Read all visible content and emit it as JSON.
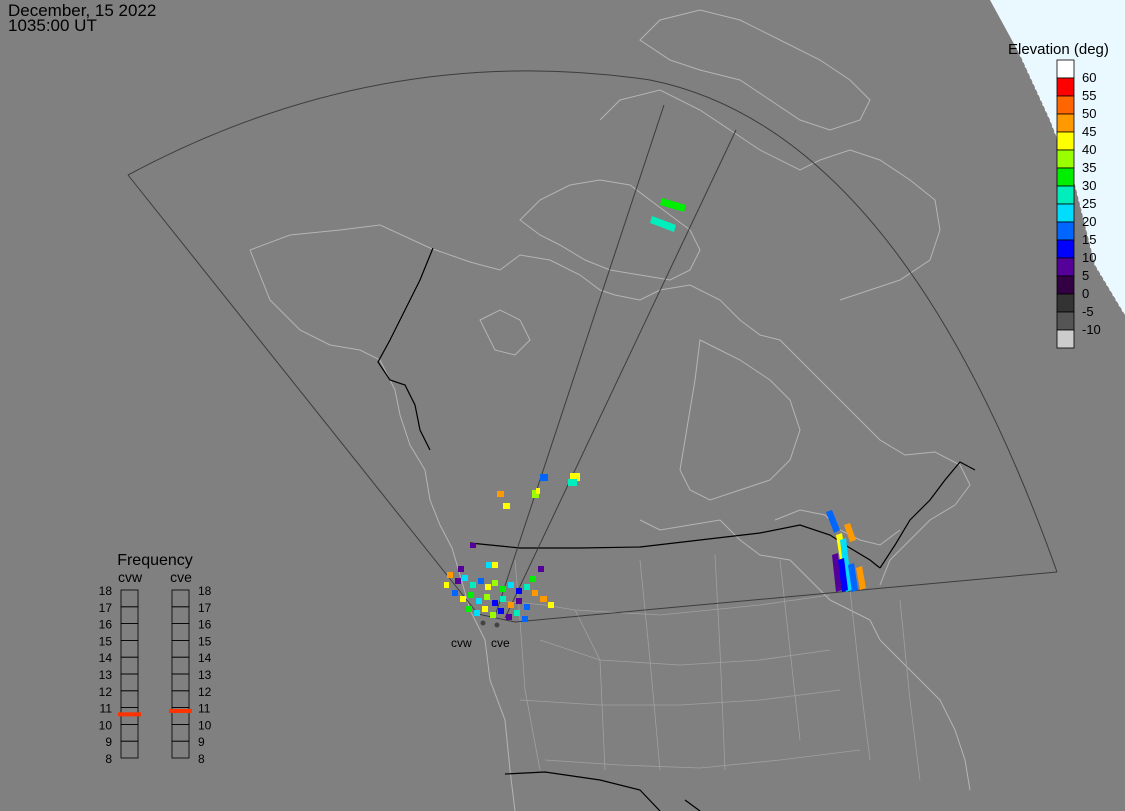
{
  "header": {
    "date": "December, 15 2022",
    "time": "1035:00 UT"
  },
  "colors": {
    "background": "#808080",
    "land_lines": "#b0b0b0",
    "borders": "#000000",
    "fov_lines": "#4a4a4a",
    "daylight_region": "#e8f8ff",
    "frequency_marker": "#ff3300"
  },
  "elevation_legend": {
    "title": "Elevation (deg)",
    "levels": [
      {
        "label": "60",
        "color": "#ffffff"
      },
      {
        "label": "55",
        "color": "#ff0000"
      },
      {
        "label": "50",
        "color": "#ff6600"
      },
      {
        "label": "45",
        "color": "#ff9900"
      },
      {
        "label": "40",
        "color": "#ffff00"
      },
      {
        "label": "35",
        "color": "#99ff00"
      },
      {
        "label": "30",
        "color": "#00ee00"
      },
      {
        "label": "25",
        "color": "#00eebb"
      },
      {
        "label": "20",
        "color": "#00ddff"
      },
      {
        "label": "15",
        "color": "#0066ff"
      },
      {
        "label": "10",
        "color": "#0000ff"
      },
      {
        "label": "5",
        "color": "#550099"
      },
      {
        "label": "0",
        "color": "#330044"
      },
      {
        "label": "-5",
        "color": "#333333"
      },
      {
        "label": "-10",
        "color": "#555555"
      },
      {
        "label": "",
        "color": "#cccccc"
      }
    ]
  },
  "frequency_panel": {
    "title": "Frequency",
    "radars": [
      {
        "name": "cvw",
        "frequency_mhz": 10.6
      },
      {
        "name": "cve",
        "frequency_mhz": 10.8
      }
    ],
    "scale": [
      "18",
      "17",
      "16",
      "15",
      "14",
      "13",
      "12",
      "11",
      "10",
      "9",
      "8"
    ]
  },
  "radar_sites": [
    {
      "name": "cvw"
    },
    {
      "name": "cve"
    }
  ]
}
